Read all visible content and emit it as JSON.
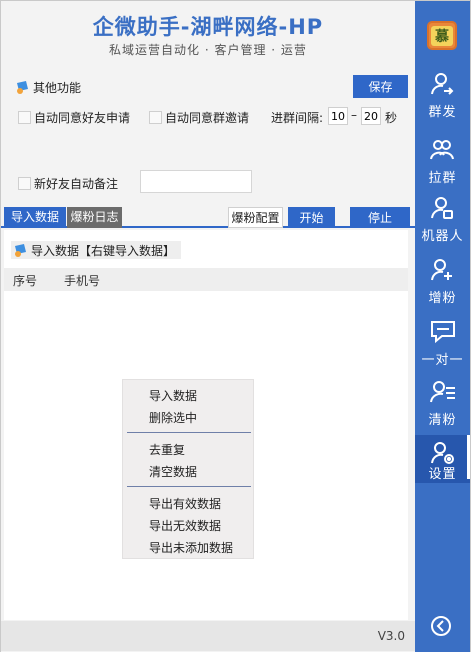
{
  "header": {
    "title": "企微助手-湖畔网络-HP",
    "subtitle": "私域运营自动化 · 客户管理 · 运营"
  },
  "settings": {
    "section_title": "其他功能",
    "save_label": "保存",
    "auto_accept_friend": "自动同意好友申请",
    "auto_accept_group": "自动同意群邀请",
    "interval_label": "进群间隔:",
    "interval_min": "10",
    "interval_dash": "–",
    "interval_max": "20",
    "interval_unit": "秒",
    "auto_remark": "新好友自动备注",
    "remark_value": ""
  },
  "tabs": {
    "import": "导入数据",
    "log": "爆粉日志",
    "config": "爆粉配置",
    "start": "开始",
    "stop": "停止"
  },
  "panel": {
    "import_title": "导入数据【右键导入数据】",
    "col_index": "序号",
    "col_phone": "手机号"
  },
  "context_menu": {
    "import": "导入数据",
    "delete_selected": "删除选中",
    "dedupe": "去重复",
    "clear": "清空数据",
    "export_valid": "导出有效数据",
    "export_invalid": "导出无效数据",
    "export_unadded": "导出未添加数据"
  },
  "footer": {
    "version": "V3.0"
  },
  "sidebar": {
    "logo_text": "慕",
    "items": [
      {
        "label": "群发",
        "icon": "user-send-icon"
      },
      {
        "label": "拉群",
        "icon": "group-icon"
      },
      {
        "label": "机器人",
        "icon": "robot-user-icon"
      },
      {
        "label": "增粉",
        "icon": "add-user-icon"
      },
      {
        "label": "一对一",
        "icon": "chat-icon"
      },
      {
        "label": "清粉",
        "icon": "user-list-icon"
      },
      {
        "label": "设置",
        "icon": "user-gear-icon"
      }
    ]
  },
  "colors": {
    "accent": "#2f67c8",
    "sidebar": "#3a6fc4",
    "sidebar_active": "#2757ad"
  }
}
